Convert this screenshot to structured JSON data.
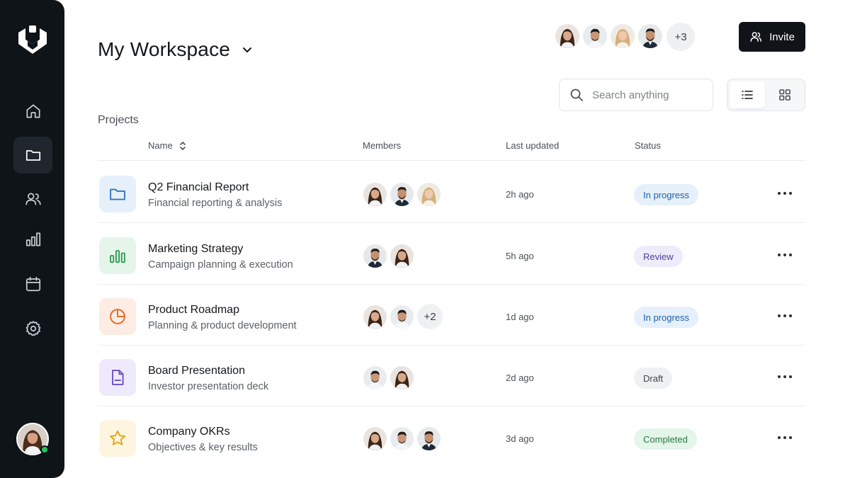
{
  "colors": {
    "sidebar_bg": "#0f1419",
    "accent_dark": "#101418",
    "online": "#22c55e"
  },
  "sidebar": {
    "logo_icon": "shield-logo-icon",
    "items": [
      {
        "name": "home",
        "icon": "home-icon",
        "active": false
      },
      {
        "name": "projects",
        "icon": "folder-icon",
        "active": true
      },
      {
        "name": "team",
        "icon": "users-icon",
        "active": false
      },
      {
        "name": "analytics",
        "icon": "bar-chart-icon",
        "active": false
      },
      {
        "name": "calendar",
        "icon": "calendar-icon",
        "active": false
      },
      {
        "name": "settings",
        "icon": "gear-icon",
        "active": false
      }
    ]
  },
  "header": {
    "workspace_title": "My Workspace",
    "member_overflow": "+3",
    "invite_label": "Invite"
  },
  "search": {
    "placeholder": "Search anything"
  },
  "view_toggle": {
    "active": "list"
  },
  "projects": {
    "section_title": "Projects",
    "columns": {
      "name": "Name",
      "members": "Members",
      "last_updated": "Last updated",
      "status": "Status"
    },
    "rows": [
      {
        "name": "Q2 Financial Report",
        "description": "Financial reporting & analysis",
        "icon": "folder-icon",
        "updated": "2h ago",
        "status": "In progress",
        "member_overflow": ""
      },
      {
        "name": "Marketing Strategy",
        "description": "Campaign planning & execution",
        "icon": "bar-chart-icon",
        "updated": "5h ago",
        "status": "Review",
        "member_overflow": ""
      },
      {
        "name": "Product Roadmap",
        "description": "Planning & product development",
        "icon": "pie-chart-icon",
        "updated": "1d ago",
        "status": "In progress",
        "member_overflow": "+2"
      },
      {
        "name": "Board Presentation",
        "description": "Investor presentation deck",
        "icon": "document-icon",
        "updated": "2d ago",
        "status": "Draft",
        "member_overflow": ""
      },
      {
        "name": "Company OKRs",
        "description": "Objectives & key results",
        "icon": "star-icon",
        "updated": "3d ago",
        "status": "Completed",
        "member_overflow": ""
      }
    ]
  }
}
